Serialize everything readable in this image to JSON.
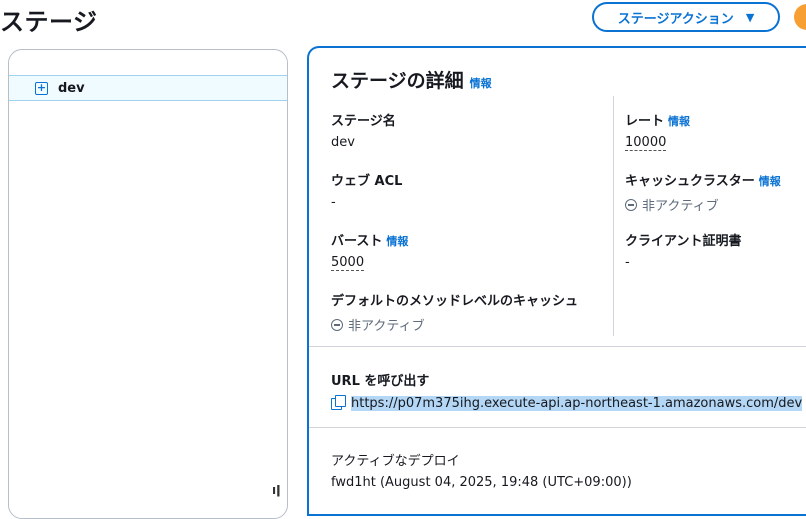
{
  "page": {
    "title": "ステージ"
  },
  "actions": {
    "label": "ステージアクション"
  },
  "tree": {
    "items": [
      {
        "label": "dev"
      }
    ]
  },
  "details": {
    "title": "ステージの詳細",
    "info_label": "情報",
    "stage_name": {
      "label": "ステージ名",
      "value": "dev"
    },
    "rate": {
      "label": "レート",
      "value": "10000"
    },
    "web_acl": {
      "label": "ウェブ ACL",
      "value": "-"
    },
    "cache_cluster": {
      "label": "キャッシュクラスター",
      "value": "非アクティブ"
    },
    "burst": {
      "label": "バースト",
      "value": "5000"
    },
    "client_cert": {
      "label": "クライアント証明書",
      "value": "-"
    },
    "default_cache": {
      "label": "デフォルトのメソッドレベルのキャッシュ",
      "value": "非アクティブ"
    },
    "invoke_url": {
      "label": "URL を呼び出す",
      "value": "https://p07m375ihg.execute-api.ap-northeast-1.amazonaws.com/dev"
    },
    "active_deploy": {
      "label": "アクティブなデプロイ",
      "value": "fwd1ht (August 04, 2025, 19:48 (UTC+09:00))"
    }
  }
}
